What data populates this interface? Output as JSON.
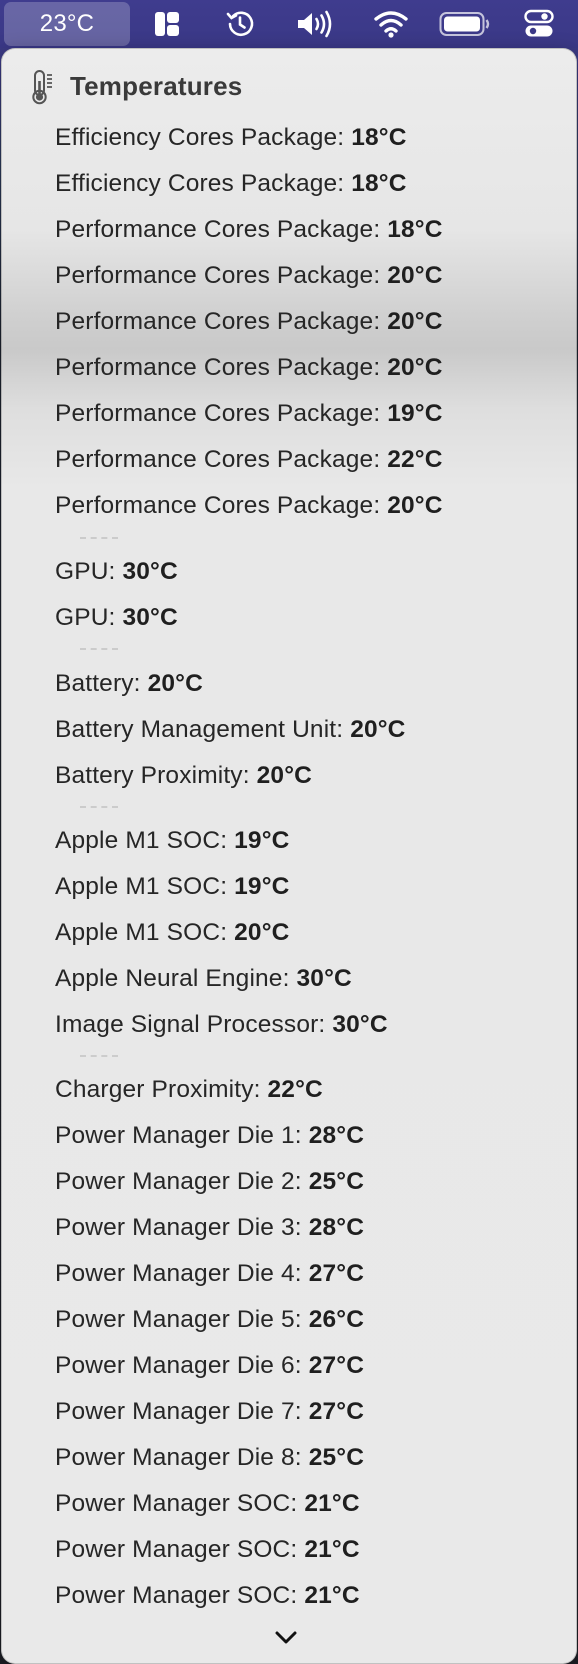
{
  "menubar": {
    "temperature": "23°C",
    "icons": [
      "stage-manager-icon",
      "time-machine-icon",
      "volume-icon",
      "wifi-icon",
      "battery-icon",
      "control-center-icon"
    ]
  },
  "panel": {
    "title": "Temperatures",
    "icon": "thermometer-icon"
  },
  "sensors": [
    {
      "label": "Efficiency Cores Package:",
      "value": "18°C"
    },
    {
      "label": "Efficiency Cores Package:",
      "value": "18°C"
    },
    {
      "label": "Performance Cores Package:",
      "value": "18°C"
    },
    {
      "label": "Performance Cores Package:",
      "value": "20°C"
    },
    {
      "label": "Performance Cores Package:",
      "value": "20°C"
    },
    {
      "label": "Performance Cores Package:",
      "value": "20°C"
    },
    {
      "label": "Performance Cores Package:",
      "value": "19°C"
    },
    {
      "label": "Performance Cores Package:",
      "value": "22°C"
    },
    {
      "label": "Performance Cores Package:",
      "value": "20°C"
    },
    {
      "label": "GPU:",
      "value": "30°C"
    },
    {
      "label": "GPU:",
      "value": "30°C"
    },
    {
      "label": "Battery:",
      "value": "20°C"
    },
    {
      "label": "Battery Management Unit:",
      "value": "20°C"
    },
    {
      "label": "Battery Proximity:",
      "value": "20°C"
    },
    {
      "label": "Apple M1 SOC:",
      "value": "19°C"
    },
    {
      "label": "Apple M1 SOC:",
      "value": "19°C"
    },
    {
      "label": "Apple M1 SOC:",
      "value": "20°C"
    },
    {
      "label": "Apple Neural Engine:",
      "value": "30°C"
    },
    {
      "label": "Image Signal Processor:",
      "value": "30°C"
    },
    {
      "label": "Charger Proximity:",
      "value": "22°C"
    },
    {
      "label": "Power Manager Die 1:",
      "value": "28°C"
    },
    {
      "label": "Power Manager Die 2:",
      "value": "25°C"
    },
    {
      "label": "Power Manager Die 3:",
      "value": "28°C"
    },
    {
      "label": "Power Manager Die 4:",
      "value": "27°C"
    },
    {
      "label": "Power Manager Die 5:",
      "value": "26°C"
    },
    {
      "label": "Power Manager Die 6:",
      "value": "27°C"
    },
    {
      "label": "Power Manager Die 7:",
      "value": "27°C"
    },
    {
      "label": "Power Manager Die 8:",
      "value": "25°C"
    },
    {
      "label": "Power Manager SOC:",
      "value": "21°C"
    },
    {
      "label": "Power Manager SOC:",
      "value": "21°C"
    },
    {
      "label": "Power Manager SOC:",
      "value": "21°C"
    }
  ],
  "scroll_indicator": "chevron-down-icon"
}
